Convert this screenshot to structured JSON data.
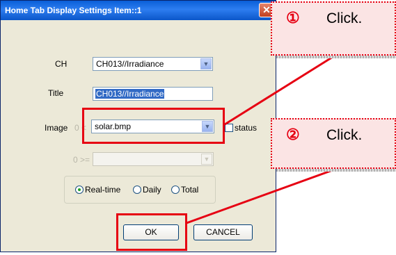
{
  "dialog": {
    "title": "Home Tab Display Settings Item::1",
    "close_glyph": "✕"
  },
  "form": {
    "ch_label": "CH",
    "ch_value": "CH013//Irradiance",
    "title_label": "Title",
    "title_value": "CH013//Irradiance",
    "image_label": "Image",
    "image_prefix": "0 <",
    "image_value": "solar.bmp",
    "status_label": "status",
    "second_prefix": "0 >=",
    "second_value": ""
  },
  "period": {
    "options": [
      "Real-time",
      "Daily",
      "Total"
    ],
    "selected": "Real-time"
  },
  "buttons": {
    "ok": "OK",
    "cancel": "CANCEL"
  },
  "annotations": {
    "step1_number": "①",
    "step1_text": "Click.",
    "step2_number": "②",
    "step2_text": "Click.",
    "color": "#e60012"
  },
  "icons": {
    "close": "close-icon",
    "dropdown": "chevron-down-icon"
  }
}
